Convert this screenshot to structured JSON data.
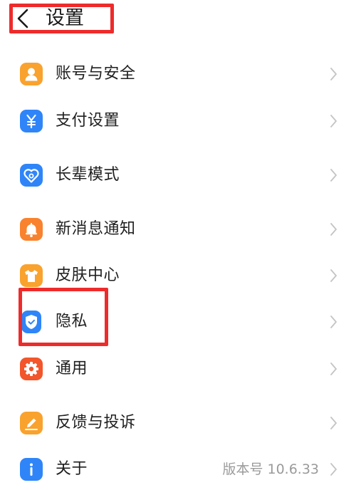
{
  "header": {
    "title": "设置",
    "back_icon": "chevron-left-icon"
  },
  "settings": [
    {
      "label": "账号与安全",
      "icon": "user-icon",
      "color": "#f9a22e"
    },
    {
      "label": "支付设置",
      "icon": "yuan-icon",
      "color": "#2f85f8"
    },
    {
      "label": "长辈模式",
      "icon": "heart-icon",
      "color": "#2f85f8"
    },
    {
      "label": "新消息通知",
      "icon": "bell-icon",
      "color": "#f9822e"
    },
    {
      "label": "皮肤中心",
      "icon": "shirt-icon",
      "color": "#f9a22e"
    },
    {
      "label": "隐私",
      "icon": "shield-icon",
      "color": "#2f85f8"
    },
    {
      "label": "通用",
      "icon": "gear-icon",
      "color": "#f2562a"
    },
    {
      "label": "反馈与投诉",
      "icon": "pencil-icon",
      "color": "#f9a22e"
    },
    {
      "label": "关于",
      "icon": "info-icon",
      "color": "#2f85f8",
      "value": "版本号 10.6.33"
    }
  ],
  "colors": {
    "highlight": "#ee2b2b",
    "chevron": "#c4c4c4",
    "value_text": "#9a9a9a"
  }
}
